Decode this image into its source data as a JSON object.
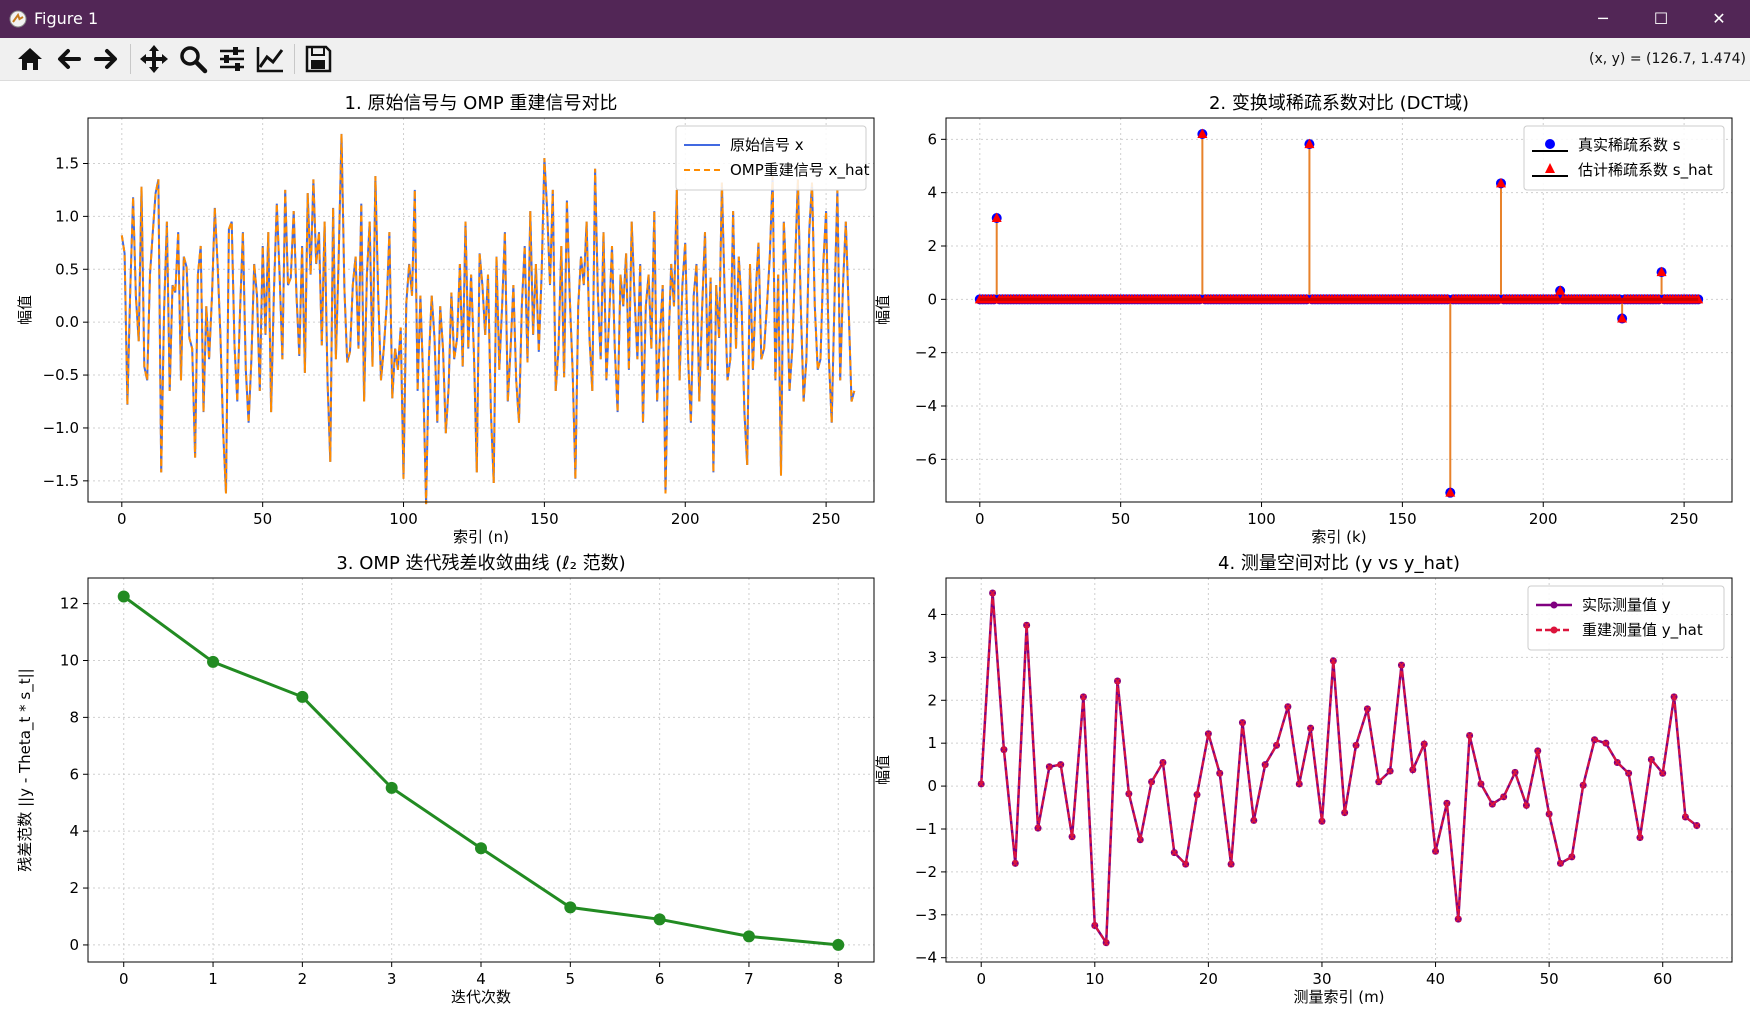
{
  "window": {
    "title": "Figure 1",
    "minimize": "─",
    "maximize": "☐",
    "close": "✕"
  },
  "toolbar": {
    "icons": [
      "home-icon",
      "back-arrow-icon",
      "forward-arrow-icon",
      "pan-icon",
      "zoom-icon",
      "configure-subplots-icon",
      "edit-axis-icon",
      "save-icon"
    ],
    "coords": "(x, y) = (126.7, 1.474)"
  },
  "colors": {
    "signal_blue": "#4169e1",
    "signal_orange": "#ff8c00",
    "stem_blue": "#0000ff",
    "stem_red": "#ff0000",
    "stem_line": "#e8822a",
    "baseline_red": "#cc0000",
    "green": "#228b22",
    "purple": "#800080",
    "crimson": "#dc143c"
  },
  "chart_data": [
    {
      "type": "line",
      "title": "1. 原始信号与 OMP 重建信号对比",
      "xlabel": "索引 (n)",
      "ylabel": "幅值",
      "xlim": [
        -12,
        267
      ],
      "ylim": [
        -1.7,
        1.93
      ],
      "xticks": [
        0,
        50,
        100,
        150,
        200,
        250
      ],
      "xtick_labels": [
        "0",
        "50",
        "100",
        "150",
        "200",
        "250"
      ],
      "yticks": [
        -1.5,
        -1.0,
        -0.5,
        0.0,
        0.5,
        1.0,
        1.5
      ],
      "ytick_labels": [
        "−1.5",
        "−1.0",
        "−0.5",
        "0.0",
        "0.5",
        "1.0",
        "1.5"
      ],
      "grid": true,
      "legend_position": "upper-right",
      "legend": [
        {
          "label": "原始信号 x",
          "color": "#4169e1",
          "style": "solid"
        },
        {
          "label": "OMP重建信号 x_hat",
          "color": "#ff8c00",
          "style": "dashed"
        }
      ],
      "x_start": 0,
      "y": [
        0.82,
        0.65,
        -0.78,
        0.32,
        1.18,
        0.24,
        -0.18,
        1.28,
        -0.42,
        -0.55,
        0.45,
        0.85,
        1.22,
        1.35,
        -1.42,
        0.12,
        0.95,
        -0.65,
        0.35,
        0.28,
        0.85,
        -0.55,
        0.62,
        0.52,
        -0.15,
        -0.25,
        -1.28,
        0.45,
        0.72,
        -0.85,
        0.15,
        -0.35,
        0.25,
        1.08,
        0.55,
        -0.12,
        -1.05,
        -1.62,
        0.88,
        0.95,
        -0.22,
        -0.75,
        0.12,
        0.85,
        -0.45,
        -0.95,
        -0.35,
        0.55,
        0.25,
        -0.65,
        0.72,
        -0.12,
        0.85,
        -0.85,
        0.28,
        1.12,
        0.45,
        -0.35,
        1.25,
        0.35,
        0.42,
        1.05,
        0.25,
        -0.32,
        0.72,
        -0.48,
        1.22,
        0.45,
        1.35,
        0.55,
        0.85,
        -0.22,
        0.95,
        -0.55,
        -1.32,
        1.08,
        -0.35,
        0.62,
        1.78,
        0.32,
        -0.38,
        -0.28,
        0.35,
        0.62,
        -0.25,
        1.12,
        -0.75,
        0.45,
        0.95,
        -0.42,
        1.38,
        0.25,
        -0.55,
        -0.25,
        0.15,
        0.85,
        -0.72,
        -0.25,
        -0.45,
        -0.05,
        -1.48,
        0.18,
        0.55,
        0.25,
        1.25,
        -0.65,
        0.25,
        -0.55,
        -1.72,
        -0.35,
        0.25,
        -0.15,
        -0.95,
        0.15,
        -0.25,
        -1.05,
        -0.62,
        0.28,
        -0.35,
        -0.15,
        0.55,
        -0.42,
        0.95,
        -0.25,
        0.45,
        -0.32,
        -1.42,
        0.65,
        0.35,
        -0.12,
        0.45,
        -0.85,
        -1.52,
        0.62,
        -0.45,
        0.15,
        0.85,
        -0.75,
        -0.25,
        0.35,
        -0.55,
        -0.95,
        0.15,
        0.72,
        -0.38,
        1.05,
        -0.12,
        0.55,
        -0.28,
        0.45,
        1.55,
        1.05,
        0.35,
        1.25,
        -0.65,
        -0.25,
        0.72,
        -0.52,
        1.15,
        0.25,
        -0.45,
        -1.48,
        0.15,
        0.62,
        0.35,
        0.95,
        -0.15,
        -0.65,
        1.45,
        0.25,
        -0.35,
        0.85,
        -0.55,
        0.05,
        0.72,
        -0.25,
        -0.85,
        0.45,
        0.15,
        0.65,
        -0.45,
        0.95,
        0.25,
        -0.35,
        0.55,
        -0.95,
        0.15,
        0.45,
        -0.25,
        1.05,
        -0.75,
        -0.15,
        0.35,
        -1.62,
        -0.28,
        0.55,
        0.15,
        1.25,
        -0.55,
        0.35,
        0.75,
        -0.35,
        -0.95,
        0.25,
        0.55,
        -0.75,
        0.15,
        0.85,
        -0.45,
        0.42,
        -1.42,
        0.35,
        -0.15,
        1.32,
        0.25,
        -0.55,
        -0.35,
        1.05,
        -0.25,
        0.62,
        0.15,
        -0.85,
        -1.35,
        0.55,
        -0.45,
        0.28,
        0.75,
        -0.35,
        -0.25,
        0.15,
        0.62,
        1.38,
        -0.55,
        0.45,
        -1.45,
        0.95,
        0.35,
        -0.65,
        -0.25,
        0.55,
        1.35,
        0.15,
        -0.75,
        -0.35,
        0.85,
        1.32,
        0.15,
        -0.45,
        -0.35,
        0.55,
        1.05,
        -0.35,
        -0.95,
        0.25,
        1.25,
        -0.55,
        0.35,
        0.95,
        0.15,
        -0.75,
        -0.65
      ]
    },
    {
      "type": "stem",
      "title": "2. 变换域稀疏系数对比 (DCT域)",
      "xlabel": "索引 (k)",
      "ylabel": "幅值",
      "xlim": [
        -12,
        267
      ],
      "ylim": [
        -7.6,
        6.8
      ],
      "xticks": [
        0,
        50,
        100,
        150,
        200,
        250
      ],
      "xtick_labels": [
        "0",
        "50",
        "100",
        "150",
        "200",
        "250"
      ],
      "yticks": [
        -6,
        -4,
        -2,
        0,
        2,
        4,
        6
      ],
      "ytick_labels": [
        "−6",
        "−4",
        "−2",
        "0",
        "2",
        "4",
        "6"
      ],
      "grid": true,
      "legend_position": "upper-right",
      "legend": [
        {
          "label": "真实稀疏系数 s",
          "color": "#0000ff",
          "marker": "circle"
        },
        {
          "label": "估计稀疏系数 s_hat",
          "color": "#ff0000",
          "marker": "triangle"
        }
      ],
      "n": 256,
      "nonzero": [
        {
          "k": 6,
          "value": 3.05
        },
        {
          "k": 79,
          "value": 6.2
        },
        {
          "k": 117,
          "value": 5.82
        },
        {
          "k": 167,
          "value": -7.25
        },
        {
          "k": 185,
          "value": 4.35
        },
        {
          "k": 206,
          "value": 0.32
        },
        {
          "k": 228,
          "value": -0.72
        },
        {
          "k": 242,
          "value": 1.02
        }
      ]
    },
    {
      "type": "line",
      "title": "3. OMP 迭代残差收敛曲线 (ℓ₂ 范数)",
      "xlabel": "迭代次数",
      "ylabel": "残差范数 ||y - Theta_t * s_t||",
      "xlim": [
        -0.4,
        8.4
      ],
      "ylim": [
        -0.6,
        12.9
      ],
      "xticks": [
        0,
        1,
        2,
        3,
        4,
        5,
        6,
        7,
        8
      ],
      "xtick_labels": [
        "0",
        "1",
        "2",
        "3",
        "4",
        "5",
        "6",
        "7",
        "8"
      ],
      "yticks": [
        0,
        2,
        4,
        6,
        8,
        10,
        12
      ],
      "ytick_labels": [
        "0",
        "2",
        "4",
        "6",
        "8",
        "10",
        "12"
      ],
      "grid": true,
      "x": [
        0,
        1,
        2,
        3,
        4,
        5,
        6,
        7,
        8
      ],
      "y": [
        12.25,
        9.95,
        8.72,
        5.52,
        3.4,
        1.32,
        0.9,
        0.3,
        0.0
      ]
    },
    {
      "type": "line",
      "title": "4. 测量空间对比 (y vs y_hat)",
      "xlabel": "测量索引 (m)",
      "ylabel": "幅值",
      "xlim": [
        -3.1,
        66.1
      ],
      "ylim": [
        -4.1,
        4.85
      ],
      "xticks": [
        0,
        10,
        20,
        30,
        40,
        50,
        60
      ],
      "xtick_labels": [
        "0",
        "10",
        "20",
        "30",
        "40",
        "50",
        "60"
      ],
      "yticks": [
        -4,
        -3,
        -2,
        -1,
        0,
        1,
        2,
        3,
        4
      ],
      "ytick_labels": [
        "−4",
        "−3",
        "−2",
        "−1",
        "0",
        "1",
        "2",
        "3",
        "4"
      ],
      "grid": true,
      "legend_position": "upper-right",
      "legend": [
        {
          "label": "实际测量值 y",
          "color": "#800080",
          "style": "solid"
        },
        {
          "label": "重建测量值 y_hat",
          "color": "#dc143c",
          "style": "dashed"
        }
      ],
      "x_start": 0,
      "y": [
        0.05,
        4.5,
        0.85,
        -1.8,
        3.75,
        -0.98,
        0.45,
        0.5,
        -1.18,
        2.08,
        -3.25,
        -3.65,
        2.45,
        -0.18,
        -1.25,
        0.1,
        0.55,
        -1.55,
        -1.82,
        -0.2,
        1.22,
        0.3,
        -1.82,
        1.48,
        -0.8,
        0.5,
        0.95,
        1.85,
        0.05,
        1.35,
        -0.82,
        2.92,
        -0.62,
        0.95,
        1.8,
        0.1,
        0.35,
        2.82,
        0.38,
        0.98,
        -1.52,
        -0.4,
        -3.1,
        1.18,
        0.05,
        -0.42,
        -0.25,
        0.32,
        -0.45,
        0.82,
        -0.65,
        -1.8,
        -1.65,
        0.02,
        1.08,
        1.0,
        0.55,
        0.3,
        -1.2,
        0.62,
        0.3,
        2.08,
        -0.72,
        -0.92
      ]
    }
  ]
}
